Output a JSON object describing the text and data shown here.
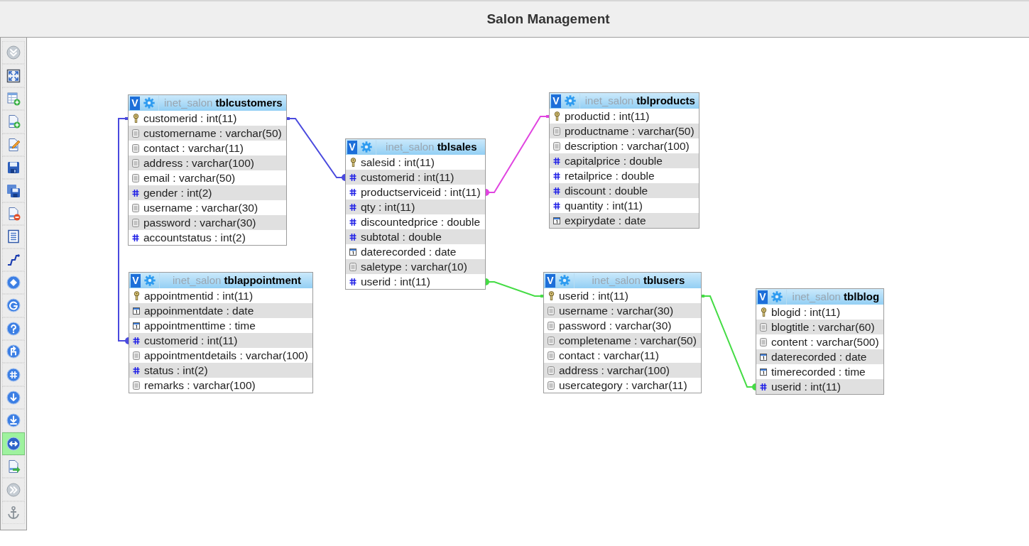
{
  "title": "Salon Management",
  "toolbar": {
    "tools": [
      {
        "on": false
      },
      {
        "on": false
      },
      {
        "on": false
      },
      {
        "on": false
      },
      {
        "on": false
      },
      {
        "on": false
      },
      {
        "on": false
      },
      {
        "on": false
      },
      {
        "on": false
      },
      {
        "on": false
      },
      {
        "on": false
      },
      {
        "on": false
      },
      {
        "on": false
      },
      {
        "on": false
      },
      {
        "on": false
      },
      {
        "on": false
      },
      {
        "on": false
      },
      {
        "on": true
      },
      {
        "on": false
      },
      {
        "on": false
      },
      {
        "on": false
      }
    ]
  },
  "tables": [
    {
      "toggle": "V",
      "database": "inet_salon",
      "name": "tblcustomers",
      "fields": [
        {
          "kind": "key",
          "text": "customerid : int(11)"
        },
        {
          "kind": "text",
          "text": "customername : varchar(50)"
        },
        {
          "kind": "text",
          "text": "contact : varchar(11)"
        },
        {
          "kind": "text",
          "text": "address : varchar(100)"
        },
        {
          "kind": "text",
          "text": "email : varchar(50)"
        },
        {
          "kind": "number",
          "text": "gender : int(2)"
        },
        {
          "kind": "text",
          "text": "username : varchar(30)"
        },
        {
          "kind": "text",
          "text": "password : varchar(30)"
        },
        {
          "kind": "number",
          "text": "accountstatus : int(2)"
        }
      ]
    },
    {
      "toggle": "V",
      "database": "inet_salon",
      "name": "tblappointment",
      "fields": [
        {
          "kind": "key",
          "text": "appointmentid : int(11)"
        },
        {
          "kind": "date",
          "text": "appoinmentdate : date"
        },
        {
          "kind": "date",
          "text": "appointmenttime : time"
        },
        {
          "kind": "number",
          "text": "customerid : int(11)"
        },
        {
          "kind": "text",
          "text": "appointmentdetails : varchar(100)"
        },
        {
          "kind": "number",
          "text": "status : int(2)"
        },
        {
          "kind": "text",
          "text": "remarks : varchar(100)"
        }
      ]
    },
    {
      "toggle": "V",
      "database": "inet_salon",
      "name": "tblsales",
      "fields": [
        {
          "kind": "key",
          "text": "salesid : int(11)"
        },
        {
          "kind": "number",
          "text": "customerid : int(11)"
        },
        {
          "kind": "number",
          "text": "productserviceid : int(11)"
        },
        {
          "kind": "number",
          "text": "qty : int(11)"
        },
        {
          "kind": "number",
          "text": "discountedprice : double"
        },
        {
          "kind": "number",
          "text": "subtotal : double"
        },
        {
          "kind": "date",
          "text": "daterecorded : date"
        },
        {
          "kind": "text",
          "text": "saletype : varchar(10)"
        },
        {
          "kind": "number",
          "text": "userid : int(11)"
        }
      ]
    },
    {
      "toggle": "V",
      "database": "inet_salon",
      "name": "tblproducts",
      "fields": [
        {
          "kind": "key",
          "text": "productid : int(11)"
        },
        {
          "kind": "text",
          "text": "productname : varchar(50)"
        },
        {
          "kind": "text",
          "text": "description : varchar(100)"
        },
        {
          "kind": "number",
          "text": "capitalprice : double"
        },
        {
          "kind": "number",
          "text": "retailprice : double"
        },
        {
          "kind": "number",
          "text": "discount : double"
        },
        {
          "kind": "number",
          "text": "quantity : int(11)"
        },
        {
          "kind": "date",
          "text": "expirydate : date"
        }
      ]
    },
    {
      "toggle": "V",
      "database": "inet_salon",
      "name": "tblusers",
      "fields": [
        {
          "kind": "key",
          "text": "userid : int(11)"
        },
        {
          "kind": "text",
          "text": "username : varchar(30)"
        },
        {
          "kind": "text",
          "text": "password : varchar(30)"
        },
        {
          "kind": "text",
          "text": "completename : varchar(50)"
        },
        {
          "kind": "text",
          "text": "contact : varchar(11)"
        },
        {
          "kind": "text",
          "text": "address : varchar(100)"
        },
        {
          "kind": "text",
          "text": "usercategory : varchar(11)"
        }
      ]
    },
    {
      "toggle": "V",
      "database": "inet_salon",
      "name": "tblblog",
      "fields": [
        {
          "kind": "key",
          "text": "blogid : int(11)"
        },
        {
          "kind": "text",
          "text": "blogtitle : varchar(60)"
        },
        {
          "kind": "text",
          "text": "content : varchar(500)"
        },
        {
          "kind": "date",
          "text": "daterecorded : date"
        },
        {
          "kind": "date",
          "text": "timerecorded : time"
        },
        {
          "kind": "number",
          "text": "userid : int(11)"
        }
      ]
    }
  ],
  "relations": [
    {
      "color": "#4a4ade"
    },
    {
      "color": "#4a4ade"
    },
    {
      "color": "#e045e0"
    },
    {
      "color": "#45dc45"
    },
    {
      "color": "#45dc45"
    }
  ]
}
